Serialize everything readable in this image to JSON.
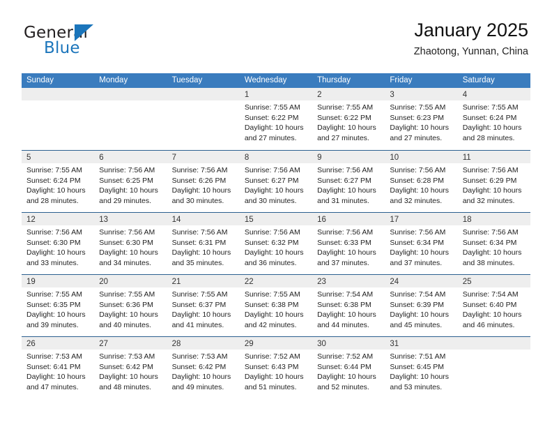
{
  "brand": {
    "word_general": "General",
    "word_blue": "Blue",
    "flag_icon": "blue-triangle-flag-icon",
    "accent_color": "#1b75bb"
  },
  "header": {
    "title": "January 2025",
    "location": "Zhaotong, Yunnan, China"
  },
  "theme": {
    "header_row_bg": "#3a7cbe",
    "header_row_text": "#ffffff",
    "week_rule": "#2b5f8f",
    "day_band_bg": "#eeeeee",
    "body_text": "#222222"
  },
  "calendar": {
    "weekday_headers": [
      "Sunday",
      "Monday",
      "Tuesday",
      "Wednesday",
      "Thursday",
      "Friday",
      "Saturday"
    ],
    "weeks": [
      [
        {
          "day": "",
          "empty": true,
          "lines": []
        },
        {
          "day": "",
          "empty": true,
          "lines": []
        },
        {
          "day": "",
          "empty": true,
          "lines": []
        },
        {
          "day": "1",
          "empty": false,
          "lines": [
            "Sunrise: 7:55 AM",
            "Sunset: 6:22 PM",
            "Daylight: 10 hours",
            "and 27 minutes."
          ]
        },
        {
          "day": "2",
          "empty": false,
          "lines": [
            "Sunrise: 7:55 AM",
            "Sunset: 6:22 PM",
            "Daylight: 10 hours",
            "and 27 minutes."
          ]
        },
        {
          "day": "3",
          "empty": false,
          "lines": [
            "Sunrise: 7:55 AM",
            "Sunset: 6:23 PM",
            "Daylight: 10 hours",
            "and 27 minutes."
          ]
        },
        {
          "day": "4",
          "empty": false,
          "lines": [
            "Sunrise: 7:55 AM",
            "Sunset: 6:24 PM",
            "Daylight: 10 hours",
            "and 28 minutes."
          ]
        }
      ],
      [
        {
          "day": "5",
          "empty": false,
          "lines": [
            "Sunrise: 7:55 AM",
            "Sunset: 6:24 PM",
            "Daylight: 10 hours",
            "and 28 minutes."
          ]
        },
        {
          "day": "6",
          "empty": false,
          "lines": [
            "Sunrise: 7:56 AM",
            "Sunset: 6:25 PM",
            "Daylight: 10 hours",
            "and 29 minutes."
          ]
        },
        {
          "day": "7",
          "empty": false,
          "lines": [
            "Sunrise: 7:56 AM",
            "Sunset: 6:26 PM",
            "Daylight: 10 hours",
            "and 30 minutes."
          ]
        },
        {
          "day": "8",
          "empty": false,
          "lines": [
            "Sunrise: 7:56 AM",
            "Sunset: 6:27 PM",
            "Daylight: 10 hours",
            "and 30 minutes."
          ]
        },
        {
          "day": "9",
          "empty": false,
          "lines": [
            "Sunrise: 7:56 AM",
            "Sunset: 6:27 PM",
            "Daylight: 10 hours",
            "and 31 minutes."
          ]
        },
        {
          "day": "10",
          "empty": false,
          "lines": [
            "Sunrise: 7:56 AM",
            "Sunset: 6:28 PM",
            "Daylight: 10 hours",
            "and 32 minutes."
          ]
        },
        {
          "day": "11",
          "empty": false,
          "lines": [
            "Sunrise: 7:56 AM",
            "Sunset: 6:29 PM",
            "Daylight: 10 hours",
            "and 32 minutes."
          ]
        }
      ],
      [
        {
          "day": "12",
          "empty": false,
          "lines": [
            "Sunrise: 7:56 AM",
            "Sunset: 6:30 PM",
            "Daylight: 10 hours",
            "and 33 minutes."
          ]
        },
        {
          "day": "13",
          "empty": false,
          "lines": [
            "Sunrise: 7:56 AM",
            "Sunset: 6:30 PM",
            "Daylight: 10 hours",
            "and 34 minutes."
          ]
        },
        {
          "day": "14",
          "empty": false,
          "lines": [
            "Sunrise: 7:56 AM",
            "Sunset: 6:31 PM",
            "Daylight: 10 hours",
            "and 35 minutes."
          ]
        },
        {
          "day": "15",
          "empty": false,
          "lines": [
            "Sunrise: 7:56 AM",
            "Sunset: 6:32 PM",
            "Daylight: 10 hours",
            "and 36 minutes."
          ]
        },
        {
          "day": "16",
          "empty": false,
          "lines": [
            "Sunrise: 7:56 AM",
            "Sunset: 6:33 PM",
            "Daylight: 10 hours",
            "and 37 minutes."
          ]
        },
        {
          "day": "17",
          "empty": false,
          "lines": [
            "Sunrise: 7:56 AM",
            "Sunset: 6:34 PM",
            "Daylight: 10 hours",
            "and 37 minutes."
          ]
        },
        {
          "day": "18",
          "empty": false,
          "lines": [
            "Sunrise: 7:56 AM",
            "Sunset: 6:34 PM",
            "Daylight: 10 hours",
            "and 38 minutes."
          ]
        }
      ],
      [
        {
          "day": "19",
          "empty": false,
          "lines": [
            "Sunrise: 7:55 AM",
            "Sunset: 6:35 PM",
            "Daylight: 10 hours",
            "and 39 minutes."
          ]
        },
        {
          "day": "20",
          "empty": false,
          "lines": [
            "Sunrise: 7:55 AM",
            "Sunset: 6:36 PM",
            "Daylight: 10 hours",
            "and 40 minutes."
          ]
        },
        {
          "day": "21",
          "empty": false,
          "lines": [
            "Sunrise: 7:55 AM",
            "Sunset: 6:37 PM",
            "Daylight: 10 hours",
            "and 41 minutes."
          ]
        },
        {
          "day": "22",
          "empty": false,
          "lines": [
            "Sunrise: 7:55 AM",
            "Sunset: 6:38 PM",
            "Daylight: 10 hours",
            "and 42 minutes."
          ]
        },
        {
          "day": "23",
          "empty": false,
          "lines": [
            "Sunrise: 7:54 AM",
            "Sunset: 6:38 PM",
            "Daylight: 10 hours",
            "and 44 minutes."
          ]
        },
        {
          "day": "24",
          "empty": false,
          "lines": [
            "Sunrise: 7:54 AM",
            "Sunset: 6:39 PM",
            "Daylight: 10 hours",
            "and 45 minutes."
          ]
        },
        {
          "day": "25",
          "empty": false,
          "lines": [
            "Sunrise: 7:54 AM",
            "Sunset: 6:40 PM",
            "Daylight: 10 hours",
            "and 46 minutes."
          ]
        }
      ],
      [
        {
          "day": "26",
          "empty": false,
          "lines": [
            "Sunrise: 7:53 AM",
            "Sunset: 6:41 PM",
            "Daylight: 10 hours",
            "and 47 minutes."
          ]
        },
        {
          "day": "27",
          "empty": false,
          "lines": [
            "Sunrise: 7:53 AM",
            "Sunset: 6:42 PM",
            "Daylight: 10 hours",
            "and 48 minutes."
          ]
        },
        {
          "day": "28",
          "empty": false,
          "lines": [
            "Sunrise: 7:53 AM",
            "Sunset: 6:42 PM",
            "Daylight: 10 hours",
            "and 49 minutes."
          ]
        },
        {
          "day": "29",
          "empty": false,
          "lines": [
            "Sunrise: 7:52 AM",
            "Sunset: 6:43 PM",
            "Daylight: 10 hours",
            "and 51 minutes."
          ]
        },
        {
          "day": "30",
          "empty": false,
          "lines": [
            "Sunrise: 7:52 AM",
            "Sunset: 6:44 PM",
            "Daylight: 10 hours",
            "and 52 minutes."
          ]
        },
        {
          "day": "31",
          "empty": false,
          "lines": [
            "Sunrise: 7:51 AM",
            "Sunset: 6:45 PM",
            "Daylight: 10 hours",
            "and 53 minutes."
          ]
        },
        {
          "day": "",
          "empty": true,
          "lines": []
        }
      ]
    ]
  }
}
